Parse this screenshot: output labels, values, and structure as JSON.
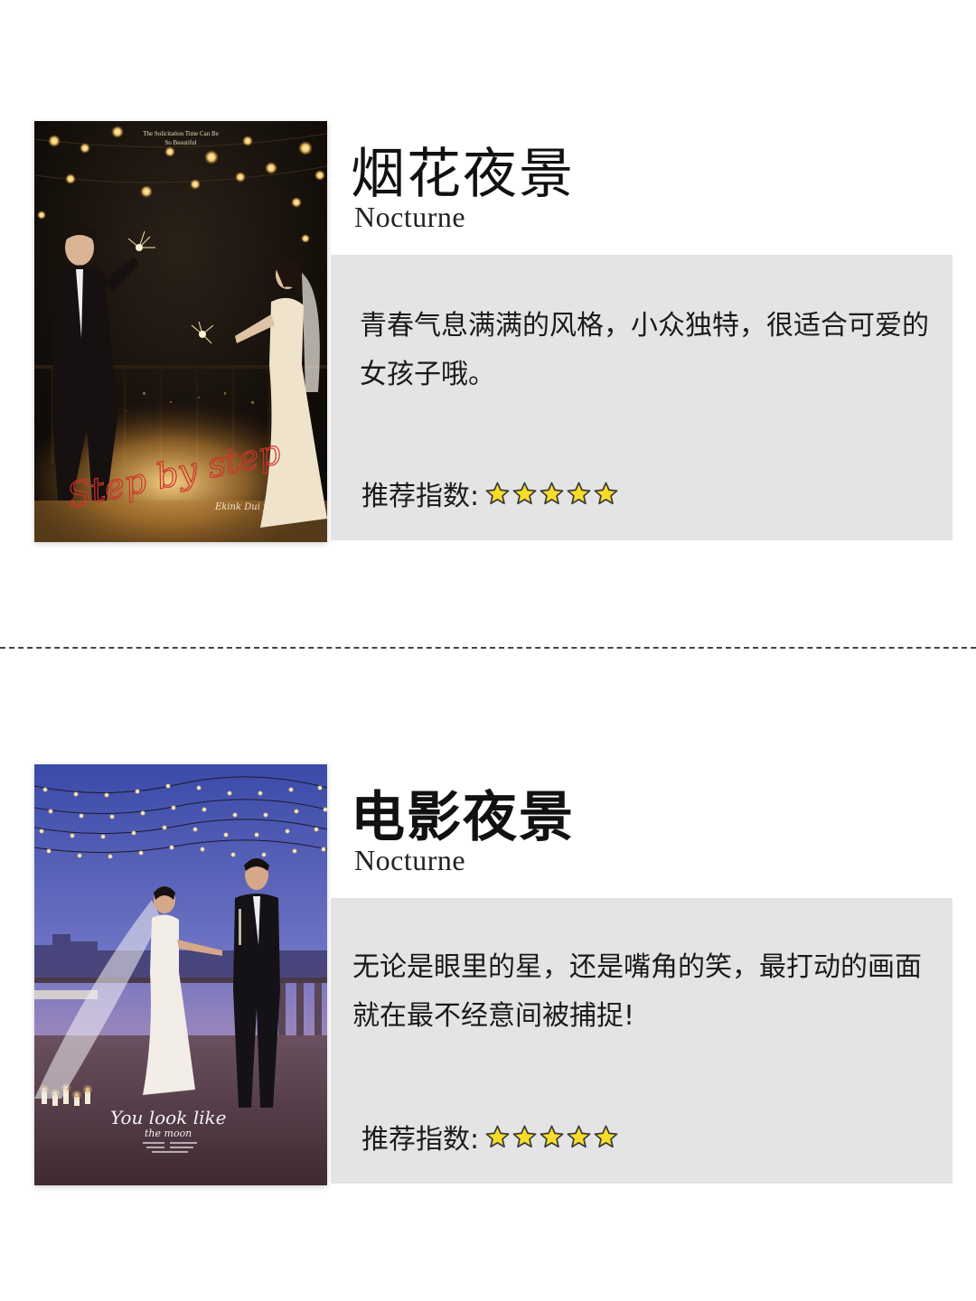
{
  "items": [
    {
      "title": "烟花夜景",
      "subtitle": "Nocturne",
      "description": "青春气息满满的风格，小众独特，很适合可爱的女孩子哦。",
      "rating_label": "推荐指数:",
      "rating": 5,
      "photo": {
        "overlay_top_line1": "The Solicitation Time Can Be",
        "overlay_top_line2": "So Beautiful",
        "script_text": "Step by step",
        "signature": "Ekink Dui you"
      }
    },
    {
      "title": "电影夜景",
      "subtitle": "Nocturne",
      "description": "无论是眼里的星，还是嘴角的笑，最打动的画面就在最不经意间被捕捉!",
      "rating_label": "推荐指数:",
      "rating": 5,
      "photo": {
        "script_text": "You look like",
        "script_text2": "the moon"
      }
    }
  ],
  "colors": {
    "panel": "#e4e4e4",
    "star": "#f7dc2a",
    "star_outline": "#3a3a3a"
  }
}
